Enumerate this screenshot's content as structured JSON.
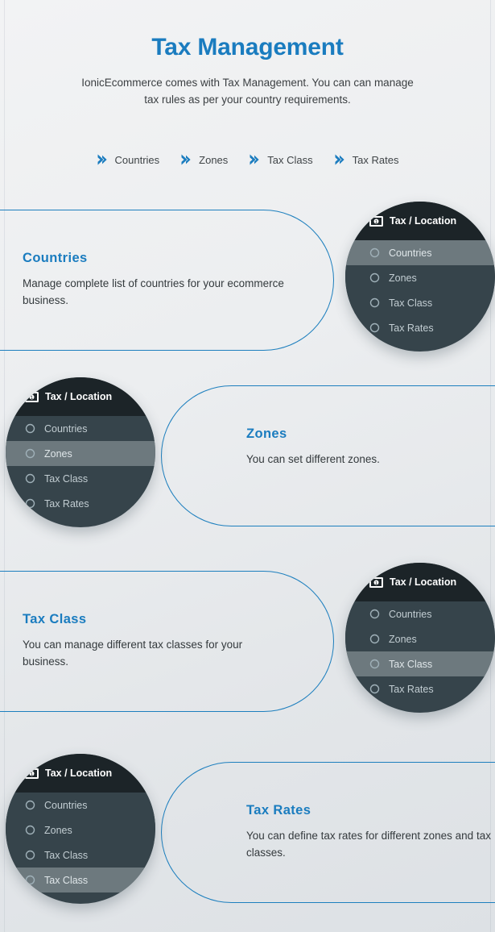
{
  "hero": {
    "title": "Tax Management",
    "subtitle": "IonicEcommerce comes with Tax Management. You can can manage tax rules as per your country requirements.",
    "chips": [
      {
        "label": "Countries",
        "icon": "chevron-right-icon"
      },
      {
        "label": "Zones",
        "icon": "chevron-right-icon"
      },
      {
        "label": "Tax Class",
        "icon": "chevron-right-icon"
      },
      {
        "label": "Tax Rates",
        "icon": "chevron-right-icon"
      }
    ]
  },
  "colors": {
    "accent_blue": "#1a7cbf",
    "border_blue": "#1d7fbe",
    "menu_header_bg": "#1c2428",
    "menu_bg": "#36444b",
    "menu_active_bg": "#6d797e",
    "menu_text": "#c2cdd2",
    "page_bg": "#eceef0"
  },
  "menu": {
    "header_label": "Tax / Location",
    "header_icon": "money-note-icon",
    "item_icon": "radio-circle-icon",
    "items": [
      "Countries",
      "Zones",
      "Tax Class",
      "Tax Rates"
    ]
  },
  "sections": [
    {
      "id": "countries",
      "title": "Countries",
      "text": "Manage complete list of countries for your ecommerce business.",
      "card_side": "left",
      "circle_side": "right",
      "menu_items": [
        "Countries",
        "Zones",
        "Tax Class",
        "Tax Rates"
      ],
      "active_index": 0
    },
    {
      "id": "zones",
      "title": "Zones",
      "text": "You can set different zones.",
      "card_side": "right",
      "circle_side": "left",
      "menu_items": [
        "Countries",
        "Zones",
        "Tax Class",
        "Tax Rates"
      ],
      "active_index": 1
    },
    {
      "id": "tax-class",
      "title": "Tax Class",
      "text": "You can manage different tax classes for your business.",
      "card_side": "left",
      "circle_side": "right",
      "menu_items": [
        "Countries",
        "Zones",
        "Tax Class",
        "Tax Rates"
      ],
      "active_index": 2
    },
    {
      "id": "tax-rates",
      "title": "Tax Rates",
      "text": "You can define tax rates for different zones and tax classes.",
      "card_side": "right",
      "circle_side": "left",
      "menu_items": [
        "Countries",
        "Zones",
        "Tax Class",
        "Tax Class"
      ],
      "active_index": 3
    }
  ]
}
